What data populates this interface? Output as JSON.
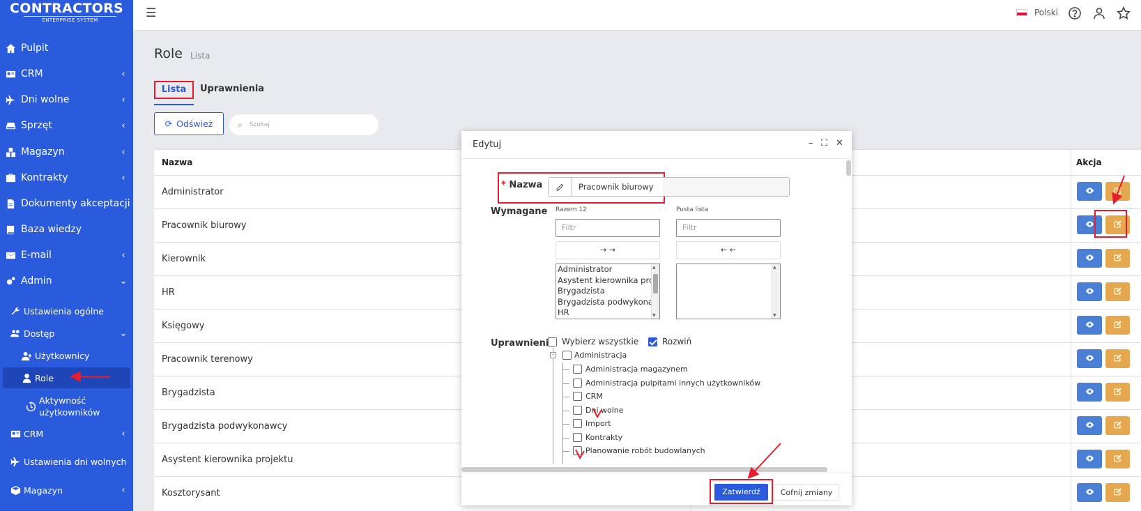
{
  "logo": {
    "brand": "CONTRACTORS",
    "tagline": "ENTERPRISE SYSTEM"
  },
  "sidebar": {
    "items": [
      {
        "label": "Pulpit",
        "icon": "home-icon"
      },
      {
        "label": "CRM",
        "icon": "id-card-icon",
        "chevron": "‹"
      },
      {
        "label": "Dni wolne",
        "icon": "plane-icon",
        "chevron": "‹"
      },
      {
        "label": "Sprzęt",
        "icon": "hdd-icon",
        "chevron": "‹"
      },
      {
        "label": "Magazyn",
        "icon": "boxes-icon",
        "chevron": "‹"
      },
      {
        "label": "Kontrakty",
        "icon": "briefcase-icon",
        "chevron": "‹"
      },
      {
        "label": "Dokumenty akceptacji",
        "icon": "file-icon"
      },
      {
        "label": "Baza wiedzy",
        "icon": "book-icon"
      },
      {
        "label": "E-mail",
        "icon": "mail-icon",
        "chevron": "‹"
      },
      {
        "label": "Admin",
        "icon": "cogs-icon",
        "chevron": "⌄"
      },
      {
        "label": "Ustawienia ogólne",
        "icon": "wrench-icon"
      },
      {
        "label": "Dostęp",
        "icon": "users-icon",
        "chevron": "⌄"
      },
      {
        "label": "Użytkownicy",
        "icon": "user-plus-icon"
      },
      {
        "label": "Role",
        "icon": "user-icon"
      },
      {
        "label": "Aktywność użytkowników",
        "icon": "history-icon"
      },
      {
        "label": "CRM",
        "icon": "id-card-icon",
        "chevron": "‹"
      },
      {
        "label": "Ustawienia dni wolnych",
        "icon": "plane-icon"
      },
      {
        "label": "Magazyn",
        "icon": "box-icon",
        "chevron": "‹"
      }
    ]
  },
  "topbar": {
    "language": "Polski"
  },
  "page": {
    "title": "Role",
    "subtitle": "Lista"
  },
  "tabs": {
    "lista": "Lista",
    "uprawnienia": "Uprawnienia"
  },
  "toolbar": {
    "refresh": "Odśwież",
    "search_placeholder": "Szukaj"
  },
  "table": {
    "col_name": "Nazwa",
    "col_action": "Akcja",
    "rows": [
      "Administrator",
      "Pracownik biurowy",
      "Kierownik",
      "HR",
      "Księgowy",
      "Pracownik terenowy",
      "Brygadzista",
      "Brygadzista podwykonawcy",
      "Asystent kierownika projektu",
      "Kosztorysant"
    ]
  },
  "modal": {
    "title": "Edytuj",
    "name_label": "Nazwa",
    "name_value": "Pracownik biurowy",
    "required_label": "Wymagane",
    "left_caption": "Razem 12",
    "right_caption": "Pusta lista",
    "filter_placeholder": "Filtr",
    "move_right": "→ →",
    "move_left": "← ←",
    "list_options": [
      "Administrator",
      "Asystent kierownika projektu",
      "Brygadzista",
      "Brygadzista podwykonawcy",
      "HR"
    ],
    "permissions_label": "Uprawnienia",
    "select_all": "Wybierz wszystkie",
    "expand": "Rozwiń",
    "tree_root": "Administracja",
    "tree_items": [
      "Administracja magazynem",
      "Administracja pulpitami innych użytkowników",
      "CRM",
      "Dni wolne",
      "Import",
      "Kontrakty",
      "Planowanie robót budowlanych"
    ],
    "confirm": "Zatwierdź",
    "revert": "Cofnij zmiany"
  },
  "colors": {
    "primary": "#2b5bdd",
    "edit": "#e6a84f",
    "view": "#4a7fd6",
    "annotation": "#e81c2a"
  }
}
